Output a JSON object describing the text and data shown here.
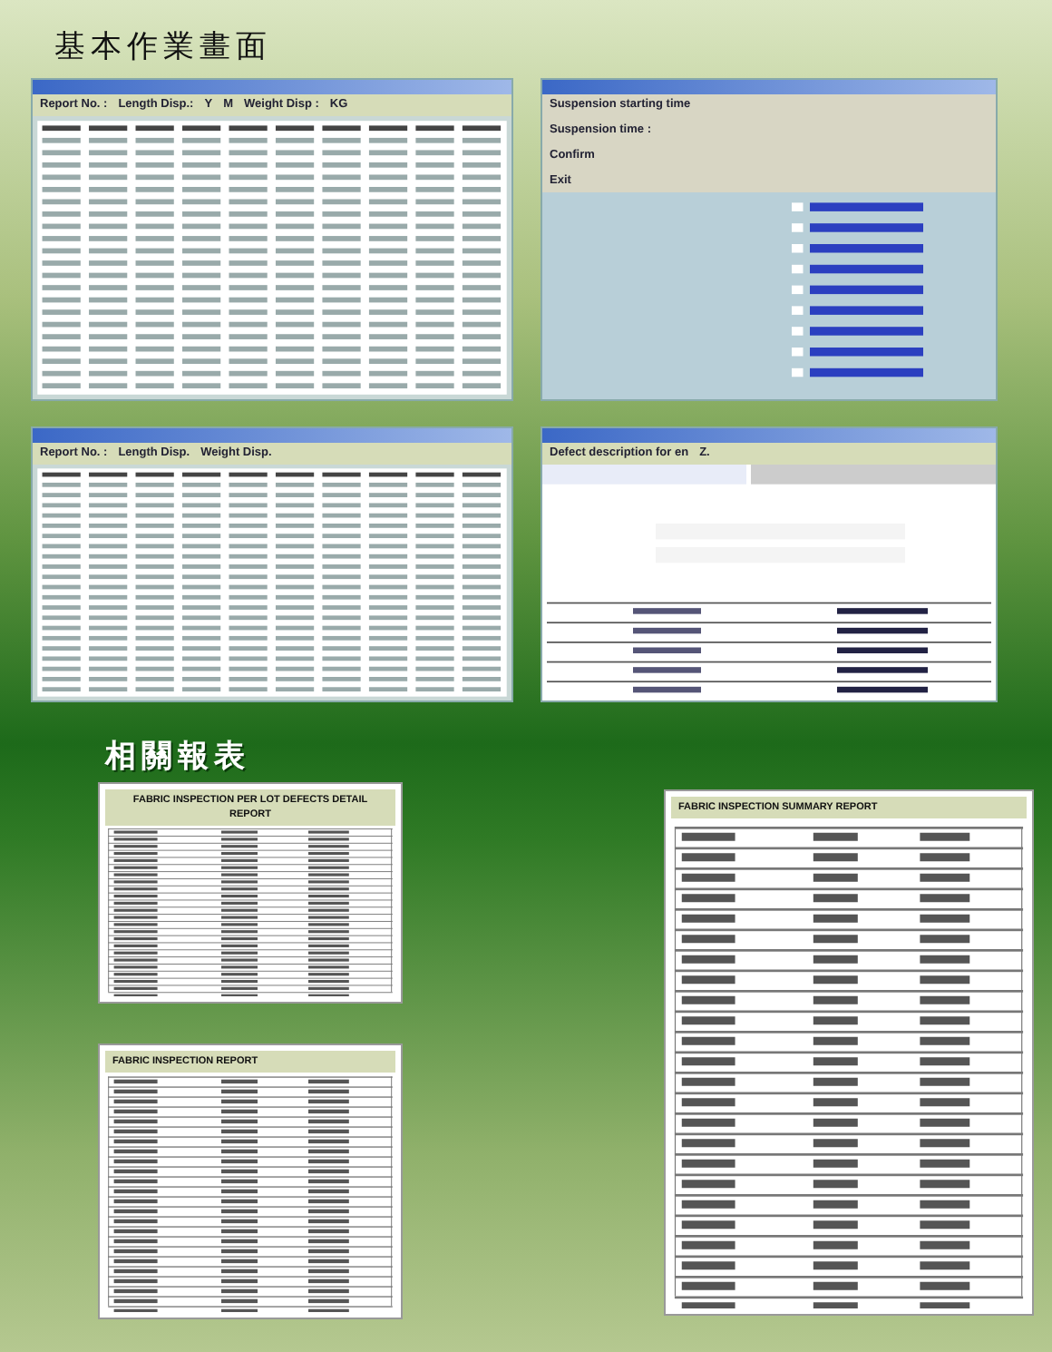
{
  "sections": [
    {
      "heading": "基本作業畫面",
      "thumbnails": [
        {
          "kind": "window",
          "labels": [
            "Report No. :",
            "Length Disp.:",
            "Y",
            "M",
            "Weight Disp :",
            "KG"
          ]
        },
        {
          "kind": "dialog",
          "labels": [
            "Suspension starting time",
            "Suspension time :",
            "Confirm",
            "Exit"
          ]
        },
        {
          "kind": "window",
          "labels": [
            "Report No. :",
            "Length Disp.",
            "Weight Disp."
          ]
        },
        {
          "kind": "form",
          "labels": [
            "Defect description for en",
            "Z."
          ]
        }
      ]
    },
    {
      "heading": "相關報表",
      "thumbnails": [
        {
          "kind": "report",
          "labels": [
            "FABRIC INSPECTION PER LOT DEFECTS DETAIL REPORT"
          ]
        },
        {
          "kind": "report",
          "labels": [
            "FABRIC INSPECTION REPORT"
          ]
        },
        {
          "kind": "report",
          "labels": [
            "FABRIC INSPECTION SUMMARY REPORT"
          ]
        }
      ]
    }
  ]
}
